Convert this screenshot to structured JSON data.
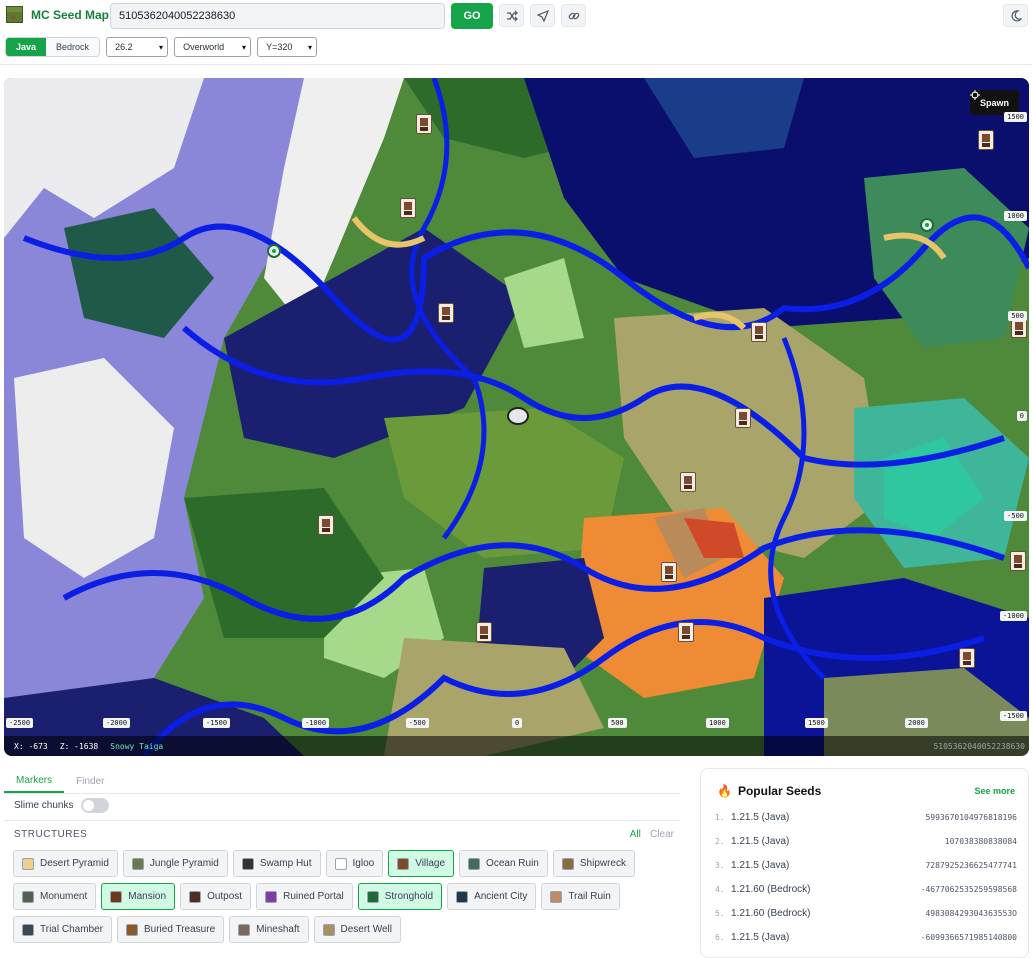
{
  "app": {
    "title": "MC Seed Map",
    "seed_value": "5105362040052238630",
    "go_label": "GO"
  },
  "toolbar": {
    "icons": [
      "shuffle-icon",
      "navigate-icon",
      "link-icon",
      "theme-icon"
    ]
  },
  "edition": {
    "java": "Java",
    "bedrock": "Bedrock"
  },
  "selects": {
    "version": "26.2",
    "dimension": "Overworld",
    "height": "Y=320"
  },
  "map": {
    "spawn_label": "Spawn",
    "x_ticks": [
      "-2500",
      "-2000",
      "-1500",
      "-1000",
      "-500",
      "0",
      "500",
      "1000",
      "1500",
      "2000"
    ],
    "y_ticks": [
      "1500",
      "1000",
      "500",
      "0",
      "-500",
      "-1000",
      "-1500"
    ],
    "coords": {
      "x": "X: -673",
      "z": "Z: -1638",
      "biome": "Snowy Taiga",
      "seed": "5105362040052238630"
    }
  },
  "tabs": {
    "markers": "Markers",
    "finder": "Finder"
  },
  "slime": {
    "label": "Slime chunks"
  },
  "structures": {
    "heading": "STRUCTURES",
    "all": "All",
    "clear": "Clear",
    "items": [
      {
        "label": "Desert Pyramid",
        "on": false,
        "color": "#e9d28a"
      },
      {
        "label": "Jungle Pyramid",
        "on": false,
        "color": "#6b7a4a"
      },
      {
        "label": "Swamp Hut",
        "on": false,
        "color": "#333333"
      },
      {
        "label": "Igloo",
        "on": false,
        "color": "#ffffff"
      },
      {
        "label": "Village",
        "on": true,
        "color": "#7c4a2e"
      },
      {
        "label": "Ocean Ruin",
        "on": false,
        "color": "#3f6f5a"
      },
      {
        "label": "Shipwreck",
        "on": false,
        "color": "#8a6a3a"
      },
      {
        "label": "Monument",
        "on": false,
        "color": "#556055"
      },
      {
        "label": "Mansion",
        "on": true,
        "color": "#6b3a1e"
      },
      {
        "label": "Outpost",
        "on": false,
        "color": "#4a3020"
      },
      {
        "label": "Ruined Portal",
        "on": false,
        "color": "#7a3fa8"
      },
      {
        "label": "Stronghold",
        "on": true,
        "color": "#1f6b3a"
      },
      {
        "label": "Ancient City",
        "on": false,
        "color": "#1e3a4a"
      },
      {
        "label": "Trail Ruin",
        "on": false,
        "color": "#c08a6a"
      },
      {
        "label": "Trial Chamber",
        "on": false,
        "color": "#3a4a55"
      },
      {
        "label": "Buried Treasure",
        "on": false,
        "color": "#8a5a2a"
      },
      {
        "label": "Mineshaft",
        "on": false,
        "color": "#7a6a5a"
      },
      {
        "label": "Desert Well",
        "on": false,
        "color": "#a89060"
      }
    ]
  },
  "popular": {
    "title": "Popular Seeds",
    "see_more": "See more",
    "rows": [
      {
        "idx": "1.",
        "version": "1.21.5 (Java)",
        "seed": "5993670104976818196"
      },
      {
        "idx": "2.",
        "version": "1.21.5 (Java)",
        "seed": "107038380838084"
      },
      {
        "idx": "3.",
        "version": "1.21.5 (Java)",
        "seed": "7287925236625477741"
      },
      {
        "idx": "4.",
        "version": "1.21.60 (Bedrock)",
        "seed": "-4677062535259598568"
      },
      {
        "idx": "5.",
        "version": "1.21.60 (Bedrock)",
        "seed": "498308429304363553O"
      },
      {
        "idx": "6.",
        "version": "1.21.5 (Java)",
        "seed": "-6099366571985140800"
      }
    ]
  }
}
